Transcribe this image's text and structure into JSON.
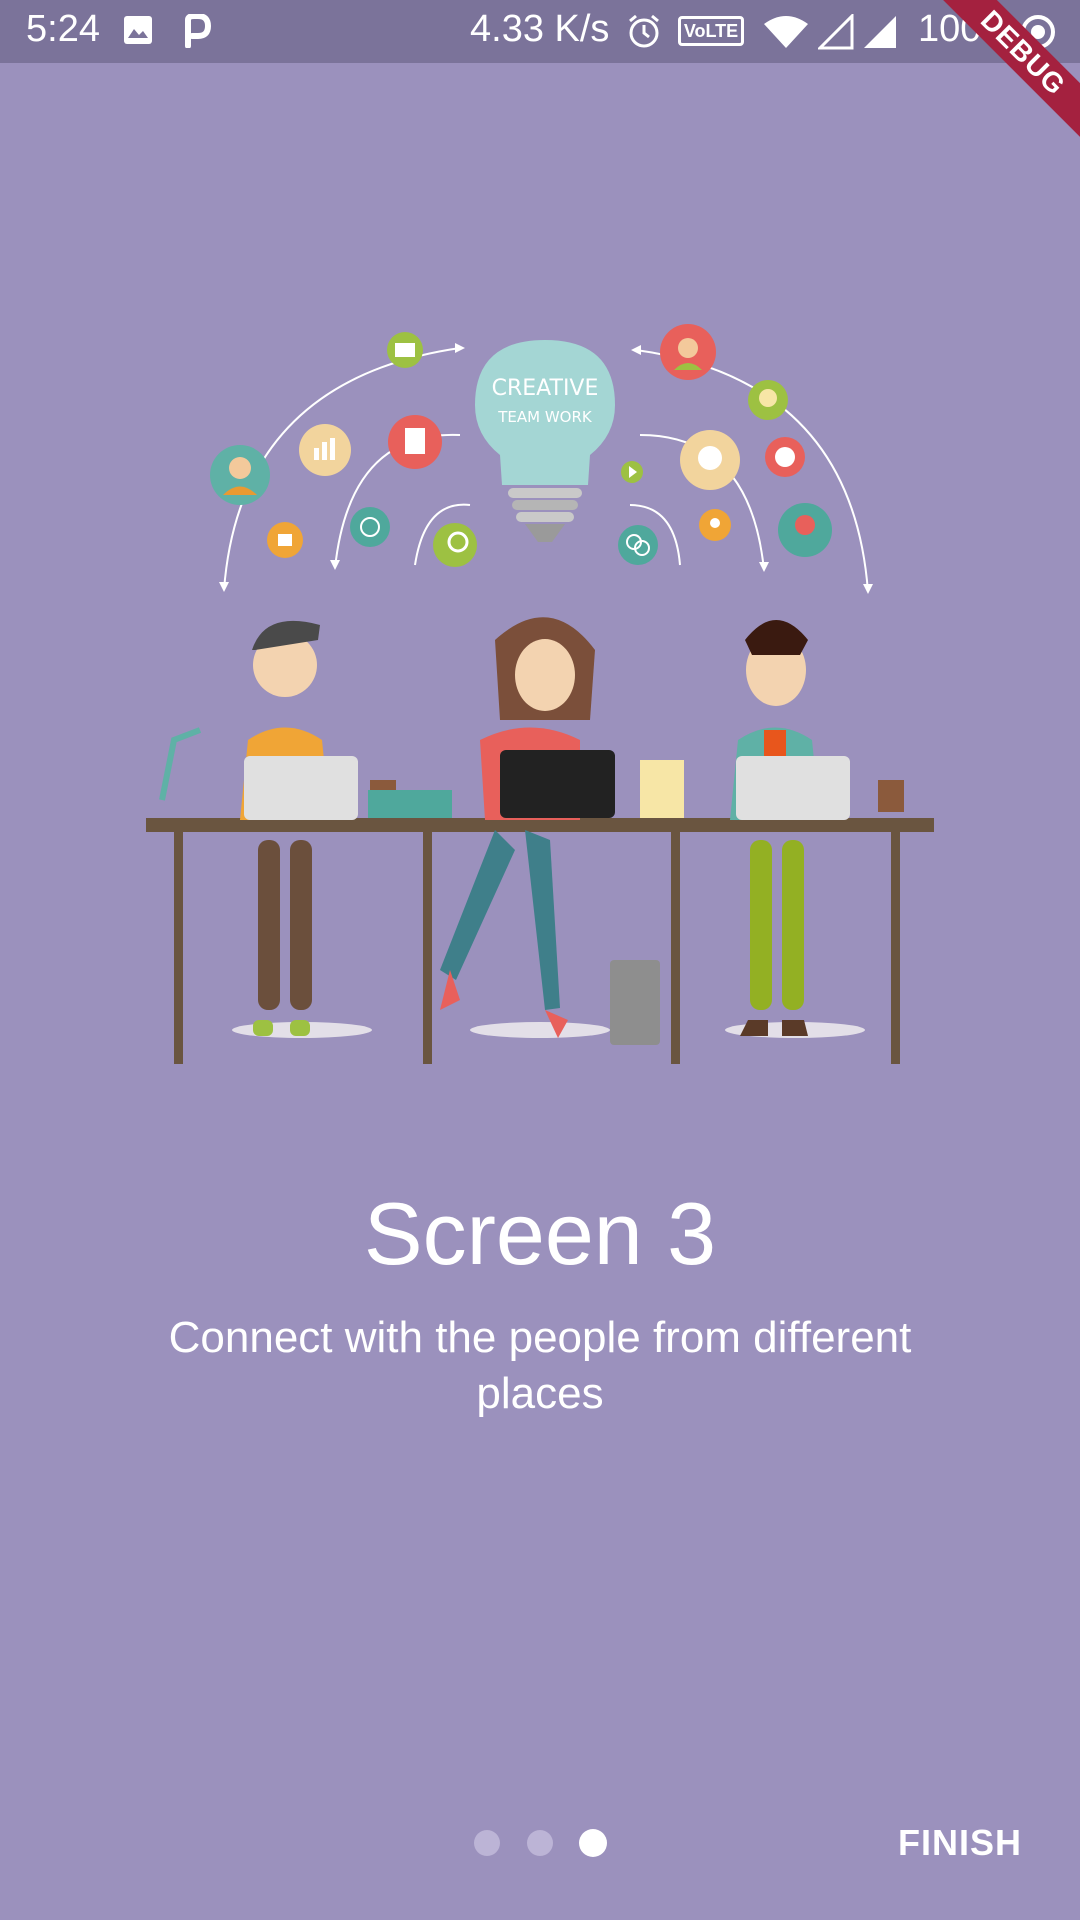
{
  "status_bar": {
    "time": "5:24",
    "network_speed": "4.33 K/s",
    "volte": "VoLTE",
    "battery": "100%",
    "icons": [
      "image-icon",
      "p-app-icon",
      "alarm-icon",
      "wifi-icon",
      "signal-icon",
      "signal-icon",
      "record-icon"
    ]
  },
  "debug_banner": "DEBUG",
  "illustration": {
    "bulb_line1": "CREATIVE",
    "bulb_line2": "TEAM WORK"
  },
  "onboarding": {
    "title": "Screen 3",
    "description": "Connect with the people from different places"
  },
  "pager": {
    "total": 3,
    "current": 3
  },
  "finish_button": "FINISH",
  "colors": {
    "background": "#9b91bd",
    "status_bar": "#7b739a",
    "debug_ribbon": "#a4213f",
    "dot_active": "#ffffff",
    "dot_inactive": "#bcb4d6"
  }
}
